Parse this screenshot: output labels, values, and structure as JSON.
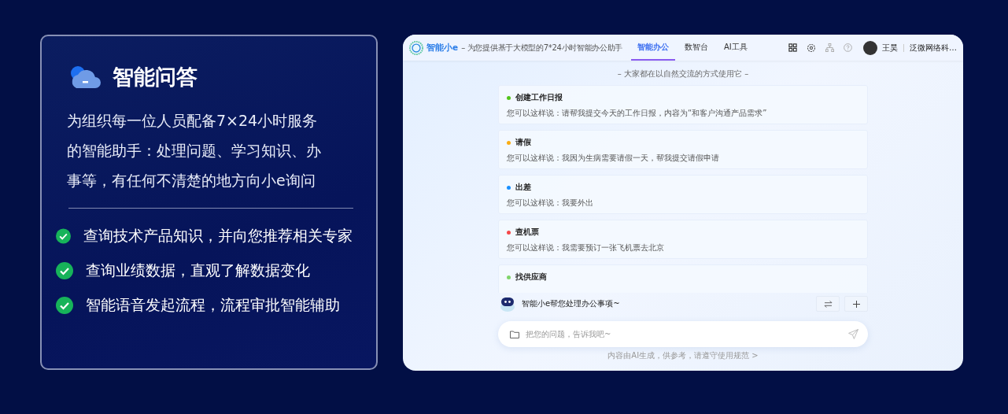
{
  "feature": {
    "title": "智能问答",
    "description": "为组织每一位人员配备7×24小时服务的智能助手：处理问题、学习知识、办事等，有任何不清楚的地方向小e询问",
    "benefits": [
      "查询技术产品知识，并向您推荐相关专家",
      "查询业绩数据，直观了解数据变化",
      "智能语音发起流程，流程审批智能辅助"
    ]
  },
  "app": {
    "brand": "智能小e",
    "tagline": "– 为您提供基于大模型的7*24小时智能办公助手",
    "tabs": [
      {
        "label": "智能办公",
        "selected": true
      },
      {
        "label": "数智台",
        "selected": false
      },
      {
        "label": "AI工具",
        "selected": false
      }
    ],
    "user": {
      "name": "王昊",
      "org": "泛微网络科…"
    },
    "subtitle": "– 大家都在以自然交流的方式使用它 –",
    "suggestions": [
      {
        "title": "创建工作日报",
        "description": "您可以这样说：请帮我提交今天的工作日报，内容为“和客户沟通产品需求”",
        "color": "#52c41a"
      },
      {
        "title": "请假",
        "description": "您可以这样说：我因为生病需要请假一天，帮我提交请假申请",
        "color": "#faad14"
      },
      {
        "title": "出差",
        "description": "您可以这样说：我要外出",
        "color": "#1890ff"
      },
      {
        "title": "查机票",
        "description": "您可以这样说：我需要预订一张飞机票去北京",
        "color": "#f5484a"
      },
      {
        "title": "找供应商",
        "color": "#7fd46a"
      }
    ],
    "assistant_message": "智能小e帮您处理办公事项~",
    "input": {
      "placeholder": "把您的问题，告诉我吧~"
    },
    "disclaimer": "内容由AI生成，供参考，请遵守使用规范 >"
  }
}
